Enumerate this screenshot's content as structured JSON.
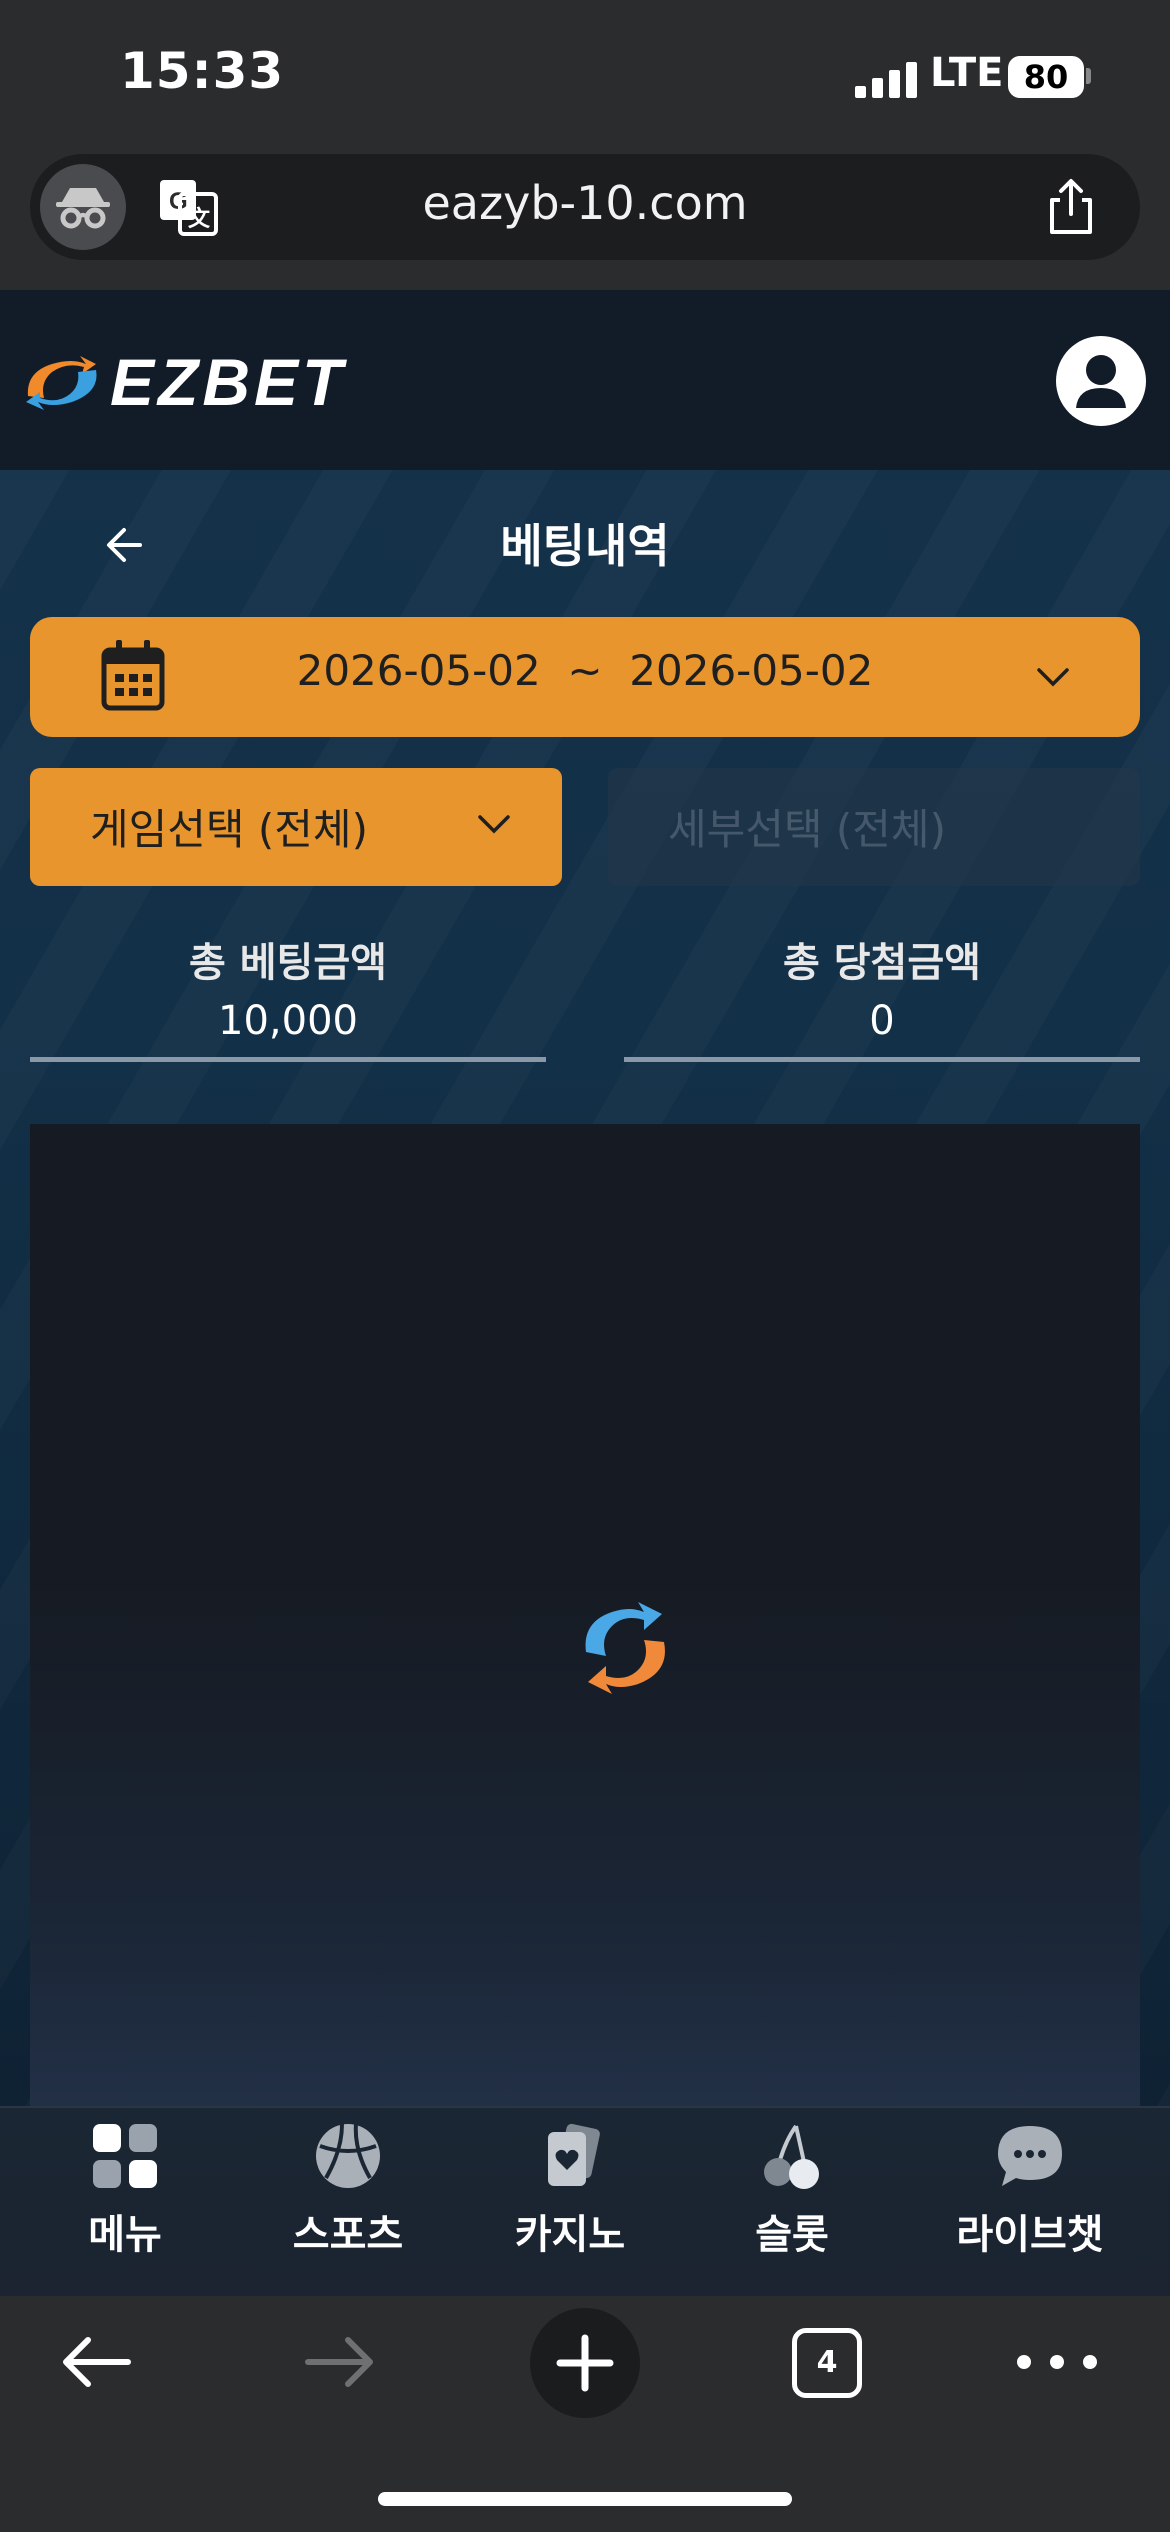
{
  "status_bar": {
    "time": "15:33",
    "network": "LTE",
    "battery": "80"
  },
  "browser": {
    "url": "eazyb-10.com",
    "tab_count": "4"
  },
  "site": {
    "brand": "EZBET"
  },
  "page": {
    "title": "베팅내역",
    "date_range": "2026-05-02  ~  2026-05-02",
    "game_select_label": "게임선택 (전체)",
    "detail_select_label": "세부선택 (전체)",
    "total_bet_label": "총 베팅금액",
    "total_bet_value": "10,000",
    "total_win_label": "총 당첨금액",
    "total_win_value": "0"
  },
  "bottom_nav": [
    {
      "label": "메뉴",
      "icon": "grid-icon"
    },
    {
      "label": "스포츠",
      "icon": "ball-icon"
    },
    {
      "label": "카지노",
      "icon": "cards-icon"
    },
    {
      "label": "슬롯",
      "icon": "cherry-icon"
    },
    {
      "label": "라이브챗",
      "icon": "chat-bubble-icon"
    }
  ],
  "colors": {
    "accent": "#e8952d",
    "header_bg": "#121c28",
    "panel_bg": "#161a22"
  }
}
